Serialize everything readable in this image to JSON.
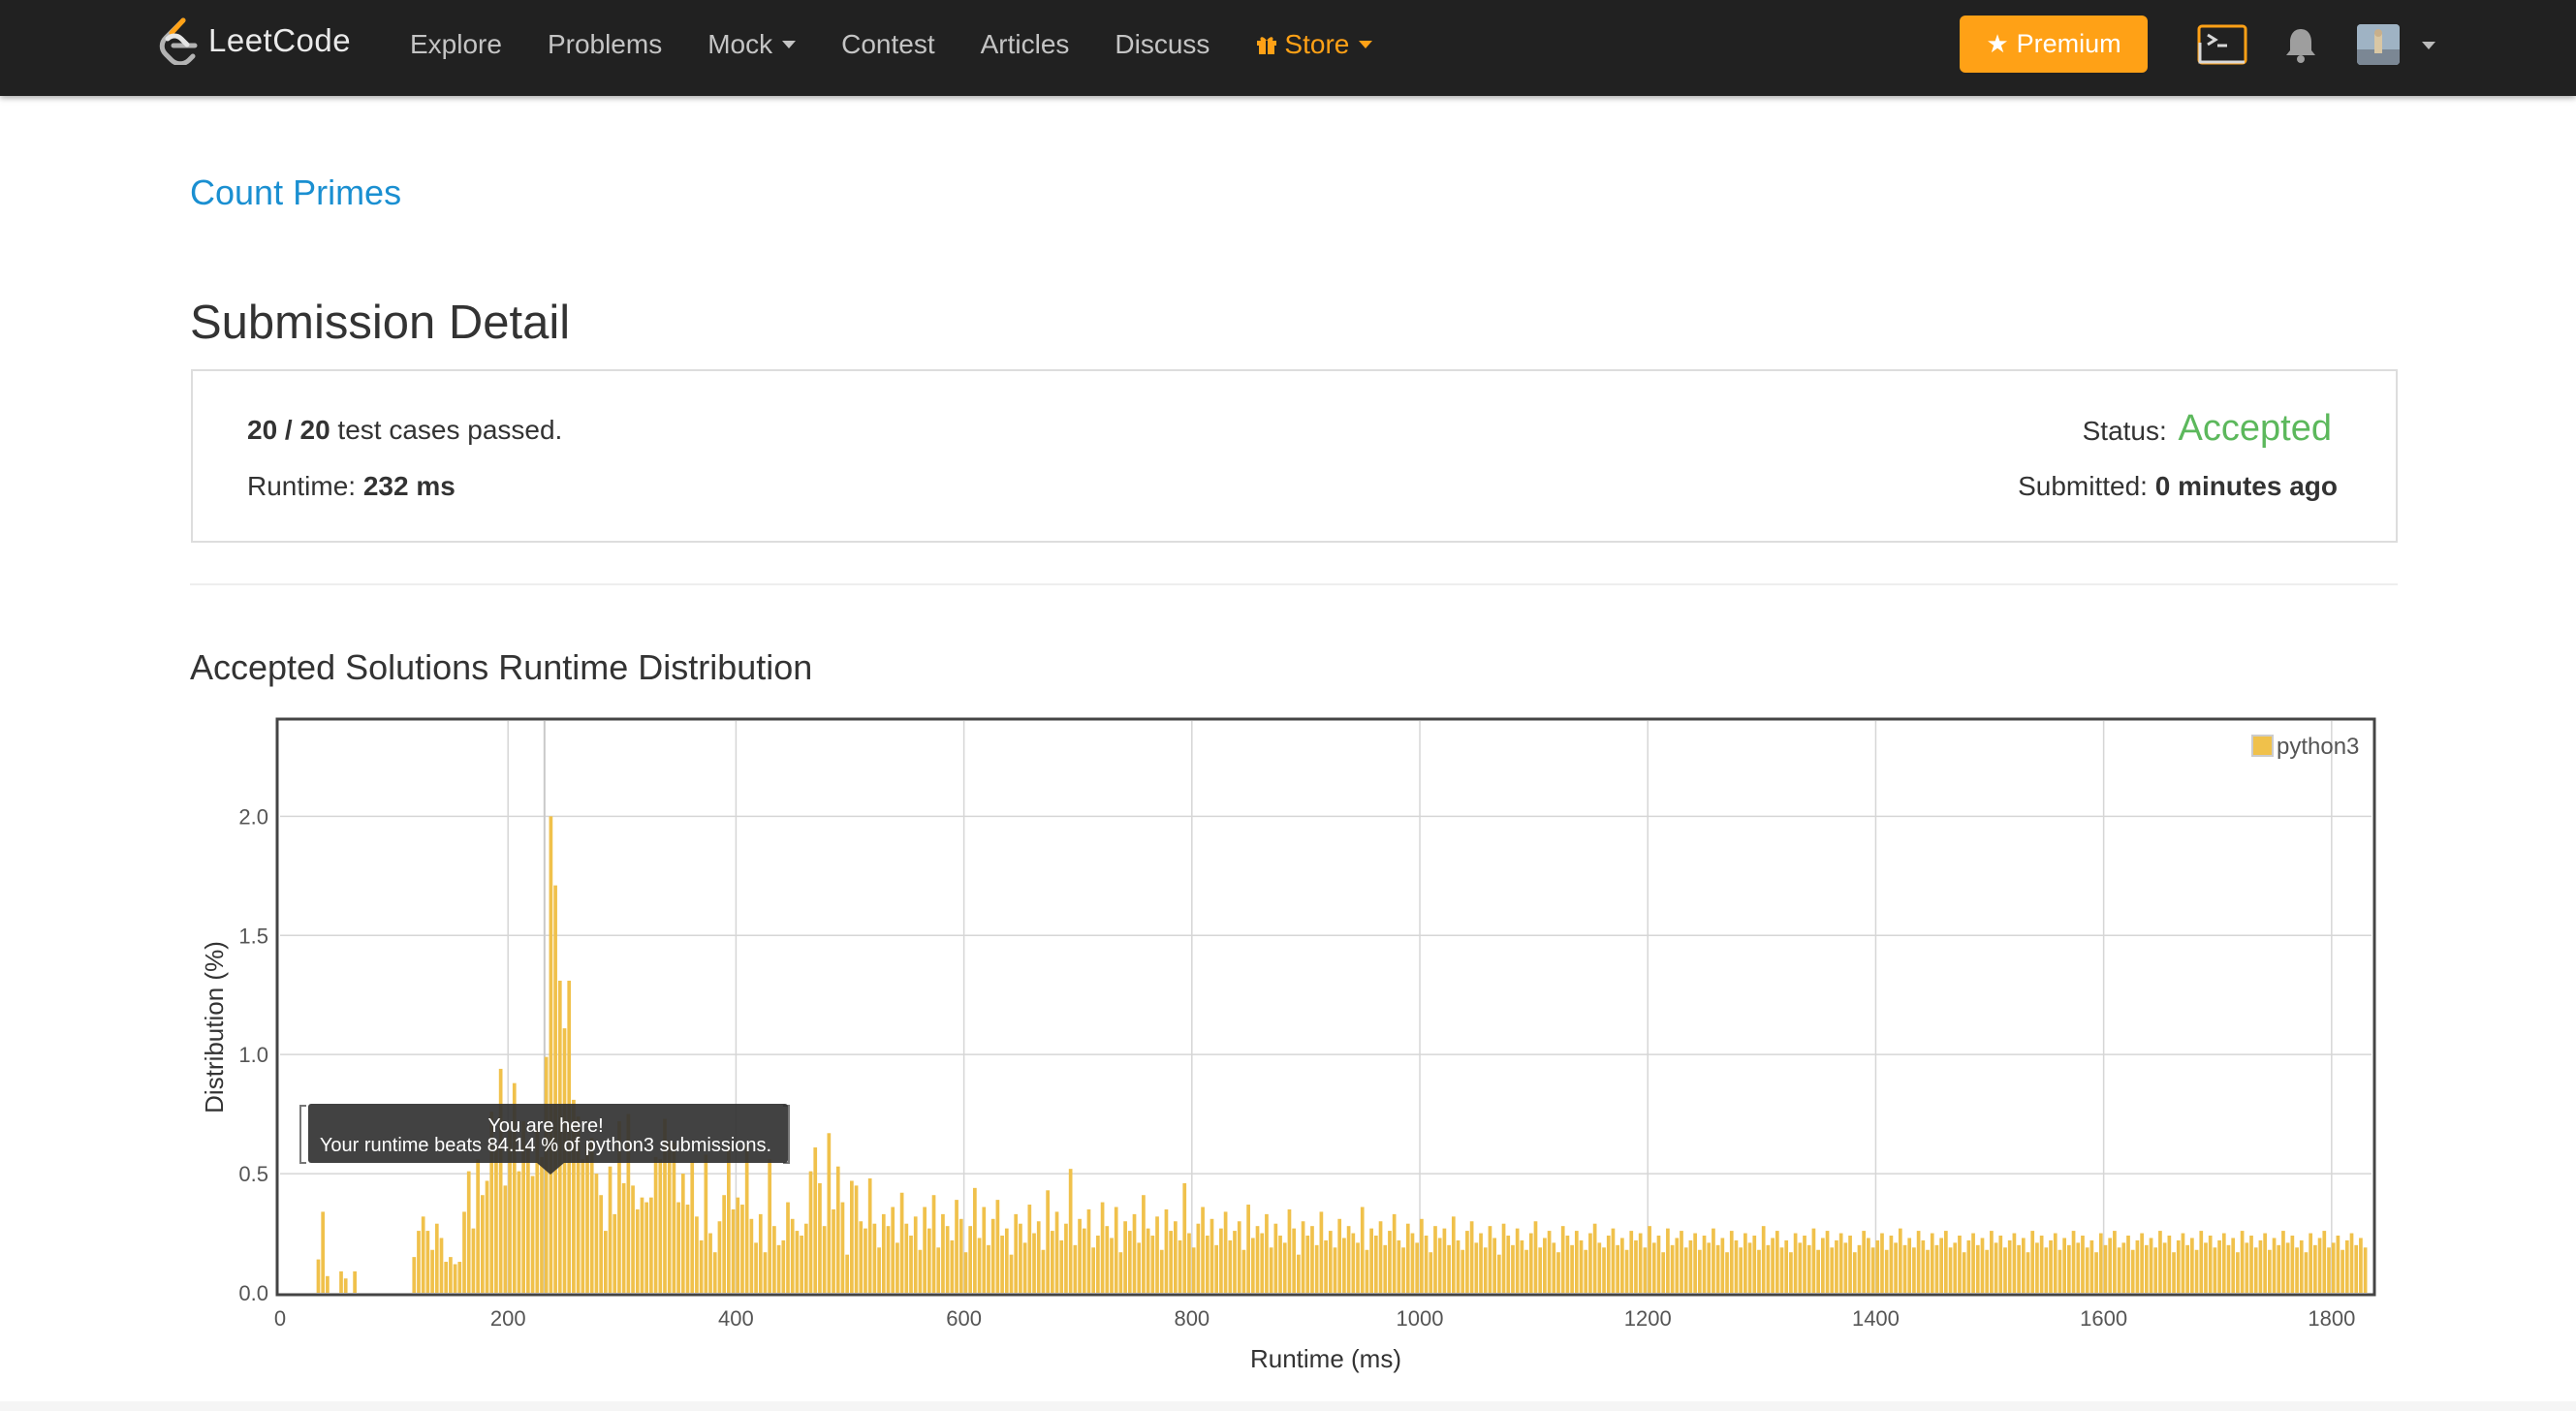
{
  "navbar": {
    "brand": "LeetCode",
    "links": [
      {
        "label": "Explore",
        "caret": false
      },
      {
        "label": "Problems",
        "caret": false
      },
      {
        "label": "Mock",
        "caret": true
      },
      {
        "label": "Contest",
        "caret": false
      },
      {
        "label": "Articles",
        "caret": false
      },
      {
        "label": "Discuss",
        "caret": false
      }
    ],
    "store_label": "Store",
    "premium_label": "Premium",
    "colors": {
      "background": "#212121",
      "accent": "#ffa116",
      "link": "#c4c4c4"
    }
  },
  "problem": {
    "title": "Count Primes"
  },
  "page_title": "Submission Detail",
  "detail": {
    "passed": "20",
    "total": "20",
    "sep": " / ",
    "passed_suffix": " test cases passed.",
    "runtime_label": "Runtime: ",
    "runtime_value": "232 ms",
    "status_label": "Status: ",
    "status_value": "Accepted",
    "submitted_label": "Submitted: ",
    "submitted_value": "0 minutes ago",
    "status_color": "#5cb85c"
  },
  "chart_section_title": "Accepted Solutions Runtime Distribution",
  "chart_data": {
    "type": "bar",
    "xlabel": "Runtime (ms)",
    "ylabel": "Distribution (%)",
    "xlim": [
      0,
      1835
    ],
    "ylim": [
      0,
      2.4
    ],
    "xticks": [
      0,
      200,
      400,
      600,
      800,
      1000,
      1200,
      1400,
      1600,
      1800
    ],
    "yticks": [
      0.0,
      0.5,
      1.0,
      1.5,
      2.0
    ],
    "ytick_labels": [
      "0.0",
      "0.5",
      "1.0",
      "1.5",
      "2.0"
    ],
    "grid": true,
    "legend_position": "top-right",
    "series": [
      {
        "name": "python3",
        "color": "#f0c14b"
      }
    ],
    "bin_width_ms": 4,
    "x": [
      32,
      36,
      40,
      52,
      56,
      64,
      116,
      120,
      124,
      128,
      132,
      136,
      140,
      144,
      148,
      152,
      156,
      160,
      164,
      168,
      172,
      176,
      180,
      184,
      188,
      192,
      196,
      200,
      204,
      208,
      212,
      216,
      220,
      224,
      228,
      232,
      236,
      240,
      244,
      248,
      252,
      256,
      260,
      264,
      268,
      272,
      276,
      280,
      284,
      288,
      292,
      296,
      300,
      304,
      308,
      312,
      316,
      320,
      324,
      328,
      332,
      336,
      340,
      344,
      348,
      352,
      356,
      360,
      364,
      368,
      372,
      376,
      380,
      384,
      388,
      392,
      396,
      400,
      404,
      408,
      412,
      416,
      420,
      424,
      428,
      432,
      436,
      440,
      444,
      448,
      452,
      456,
      460,
      464,
      468,
      472,
      476,
      480,
      484,
      488,
      492,
      496,
      500,
      504,
      508,
      512,
      516,
      520,
      524,
      528,
      532,
      536,
      540,
      544,
      548,
      552,
      556,
      560,
      564,
      568,
      572,
      576,
      580,
      584,
      588,
      592,
      596,
      600,
      604,
      608,
      612,
      616,
      620,
      624,
      628,
      632,
      636,
      640,
      644,
      648,
      652,
      656,
      660,
      664,
      668,
      672,
      676,
      680,
      684,
      688,
      692,
      696,
      700,
      704,
      708,
      712,
      716,
      720,
      724,
      728,
      732,
      736,
      740,
      744,
      748,
      752,
      756,
      760,
      764,
      768,
      772,
      776,
      780,
      784,
      788,
      792,
      796,
      800,
      804,
      808,
      812,
      816,
      820,
      824,
      828,
      832,
      836,
      840,
      844,
      848,
      852,
      856,
      860,
      864,
      868,
      872,
      876,
      880,
      884,
      888,
      892,
      896,
      900,
      904,
      908,
      912,
      916,
      920,
      924,
      928,
      932,
      936,
      940,
      944,
      948,
      952,
      956,
      960,
      964,
      968,
      972,
      976,
      980,
      984,
      988,
      992,
      996,
      1000,
      1004,
      1008,
      1012,
      1016,
      1020,
      1024,
      1028,
      1032,
      1036,
      1040,
      1044,
      1048,
      1052,
      1056,
      1060,
      1064,
      1068,
      1072,
      1076,
      1080,
      1084,
      1088,
      1092,
      1096,
      1100,
      1104,
      1108,
      1112,
      1116,
      1120,
      1124,
      1128,
      1132,
      1136,
      1140,
      1144,
      1148,
      1152,
      1156,
      1160,
      1164,
      1168,
      1172,
      1176,
      1180,
      1184,
      1188,
      1192,
      1196,
      1200,
      1204,
      1208,
      1212,
      1216,
      1220,
      1224,
      1228,
      1232,
      1236,
      1240,
      1244,
      1248,
      1252,
      1256,
      1260,
      1264,
      1268,
      1272,
      1276,
      1280,
      1284,
      1288,
      1292,
      1296,
      1300,
      1304,
      1308,
      1312,
      1316,
      1320,
      1324,
      1328,
      1332,
      1336,
      1340,
      1344,
      1348,
      1352,
      1356,
      1360,
      1364,
      1368,
      1372,
      1376,
      1380,
      1384,
      1388,
      1392,
      1396,
      1400,
      1404,
      1408,
      1412,
      1416,
      1420,
      1424,
      1428,
      1432,
      1436,
      1440,
      1444,
      1448,
      1452,
      1456,
      1460,
      1464,
      1468,
      1472,
      1476,
      1480,
      1484,
      1488,
      1492,
      1496,
      1500,
      1504,
      1508,
      1512,
      1516,
      1520,
      1524,
      1528,
      1532,
      1536,
      1540,
      1544,
      1548,
      1552,
      1556,
      1560,
      1564,
      1568,
      1572,
      1576,
      1580,
      1584,
      1588,
      1592,
      1596,
      1600,
      1604,
      1608,
      1612,
      1616,
      1620,
      1624,
      1628,
      1632,
      1636,
      1640,
      1644,
      1648,
      1652,
      1656,
      1660,
      1664,
      1668,
      1672,
      1676,
      1680,
      1684,
      1688,
      1692,
      1696,
      1700,
      1704,
      1708,
      1712,
      1716,
      1720,
      1724,
      1728,
      1732,
      1736,
      1740,
      1744,
      1748,
      1752,
      1756,
      1760,
      1764,
      1768,
      1772,
      1776,
      1780,
      1784,
      1788,
      1792,
      1796,
      1800,
      1804,
      1808,
      1812,
      1816,
      1820,
      1824,
      1828
    ],
    "values": [
      0.14,
      0.34,
      0.07,
      0.09,
      0.06,
      0.09,
      0.15,
      0.26,
      0.32,
      0.26,
      0.18,
      0.29,
      0.23,
      0.13,
      0.15,
      0.12,
      0.13,
      0.34,
      0.51,
      0.27,
      0.56,
      0.41,
      0.47,
      0.76,
      0.62,
      0.94,
      0.45,
      0.68,
      0.88,
      0.51,
      0.72,
      0.62,
      0.49,
      0.69,
      0.57,
      0.99,
      2.0,
      1.71,
      1.31,
      1.11,
      1.31,
      0.81,
      0.74,
      0.56,
      0.63,
      0.65,
      0.5,
      0.41,
      0.26,
      0.53,
      0.33,
      0.72,
      0.46,
      0.75,
      0.45,
      0.35,
      0.4,
      0.38,
      0.4,
      0.57,
      0.56,
      0.73,
      0.64,
      0.63,
      0.38,
      0.5,
      0.37,
      0.55,
      0.32,
      0.22,
      0.58,
      0.25,
      0.17,
      0.3,
      0.41,
      0.62,
      0.35,
      0.4,
      0.37,
      0.62,
      0.31,
      0.21,
      0.33,
      0.17,
      0.56,
      0.28,
      0.2,
      0.22,
      0.38,
      0.31,
      0.26,
      0.24,
      0.29,
      0.51,
      0.61,
      0.46,
      0.28,
      0.67,
      0.35,
      0.53,
      0.38,
      0.16,
      0.47,
      0.45,
      0.3,
      0.27,
      0.48,
      0.29,
      0.19,
      0.33,
      0.28,
      0.36,
      0.21,
      0.42,
      0.29,
      0.24,
      0.32,
      0.18,
      0.36,
      0.27,
      0.41,
      0.19,
      0.33,
      0.28,
      0.22,
      0.39,
      0.31,
      0.17,
      0.28,
      0.44,
      0.23,
      0.36,
      0.2,
      0.31,
      0.39,
      0.24,
      0.27,
      0.16,
      0.33,
      0.29,
      0.21,
      0.37,
      0.25,
      0.3,
      0.18,
      0.43,
      0.26,
      0.34,
      0.22,
      0.29,
      0.52,
      0.2,
      0.31,
      0.27,
      0.35,
      0.19,
      0.24,
      0.38,
      0.28,
      0.23,
      0.36,
      0.17,
      0.3,
      0.26,
      0.33,
      0.21,
      0.41,
      0.27,
      0.24,
      0.32,
      0.18,
      0.35,
      0.26,
      0.3,
      0.22,
      0.46,
      0.25,
      0.19,
      0.29,
      0.36,
      0.24,
      0.31,
      0.2,
      0.27,
      0.34,
      0.22,
      0.26,
      0.3,
      0.18,
      0.37,
      0.23,
      0.28,
      0.25,
      0.33,
      0.19,
      0.29,
      0.24,
      0.21,
      0.35,
      0.27,
      0.16,
      0.3,
      0.24,
      0.28,
      0.2,
      0.34,
      0.22,
      0.26,
      0.19,
      0.31,
      0.23,
      0.28,
      0.25,
      0.21,
      0.36,
      0.18,
      0.27,
      0.24,
      0.3,
      0.2,
      0.26,
      0.33,
      0.22,
      0.19,
      0.29,
      0.25,
      0.21,
      0.31,
      0.24,
      0.17,
      0.28,
      0.23,
      0.27,
      0.2,
      0.32,
      0.22,
      0.18,
      0.26,
      0.3,
      0.21,
      0.25,
      0.19,
      0.28,
      0.23,
      0.16,
      0.29,
      0.24,
      0.2,
      0.27,
      0.22,
      0.18,
      0.25,
      0.3,
      0.19,
      0.23,
      0.26,
      0.21,
      0.17,
      0.28,
      0.24,
      0.2,
      0.26,
      0.22,
      0.18,
      0.25,
      0.29,
      0.21,
      0.19,
      0.24,
      0.27,
      0.2,
      0.23,
      0.18,
      0.26,
      0.22,
      0.25,
      0.19,
      0.28,
      0.21,
      0.24,
      0.17,
      0.27,
      0.2,
      0.23,
      0.26,
      0.19,
      0.22,
      0.25,
      0.18,
      0.24,
      0.21,
      0.27,
      0.2,
      0.23,
      0.17,
      0.26,
      0.22,
      0.19,
      0.25,
      0.21,
      0.24,
      0.18,
      0.28,
      0.2,
      0.23,
      0.26,
      0.19,
      0.22,
      0.17,
      0.25,
      0.21,
      0.24,
      0.2,
      0.27,
      0.18,
      0.23,
      0.26,
      0.19,
      0.22,
      0.25,
      0.21,
      0.24,
      0.17,
      0.2,
      0.26,
      0.23,
      0.19,
      0.22,
      0.25,
      0.18,
      0.24,
      0.21,
      0.27,
      0.2,
      0.23,
      0.19,
      0.26,
      0.22,
      0.18,
      0.25,
      0.2,
      0.23,
      0.26,
      0.19,
      0.21,
      0.24,
      0.17,
      0.22,
      0.25,
      0.2,
      0.23,
      0.18,
      0.26,
      0.21,
      0.24,
      0.19,
      0.22,
      0.25,
      0.2,
      0.23,
      0.17,
      0.26,
      0.21,
      0.24,
      0.19,
      0.22,
      0.25,
      0.18,
      0.23,
      0.2,
      0.26,
      0.21,
      0.24,
      0.19,
      0.22,
      0.17,
      0.25,
      0.2,
      0.23,
      0.26,
      0.19,
      0.21,
      0.24,
      0.18,
      0.22,
      0.25,
      0.2,
      0.23,
      0.19,
      0.26,
      0.21,
      0.24,
      0.17,
      0.22,
      0.25,
      0.2,
      0.23,
      0.18,
      0.26,
      0.21,
      0.24,
      0.19,
      0.22,
      0.25,
      0.2,
      0.23,
      0.17,
      0.26,
      0.21,
      0.24,
      0.19,
      0.22,
      0.25,
      0.18,
      0.23,
      0.2,
      0.26,
      0.21,
      0.24,
      0.19,
      0.22,
      0.17,
      0.25,
      0.2,
      0.23,
      0.26,
      0.19,
      0.21,
      0.24,
      0.18,
      0.22,
      0.25,
      0.2,
      0.23,
      0.19
    ],
    "annotation": {
      "x": 232,
      "y": 0.5,
      "title": "You are here!",
      "text": "Your runtime beats 84.14 % of python3 submissions."
    }
  }
}
